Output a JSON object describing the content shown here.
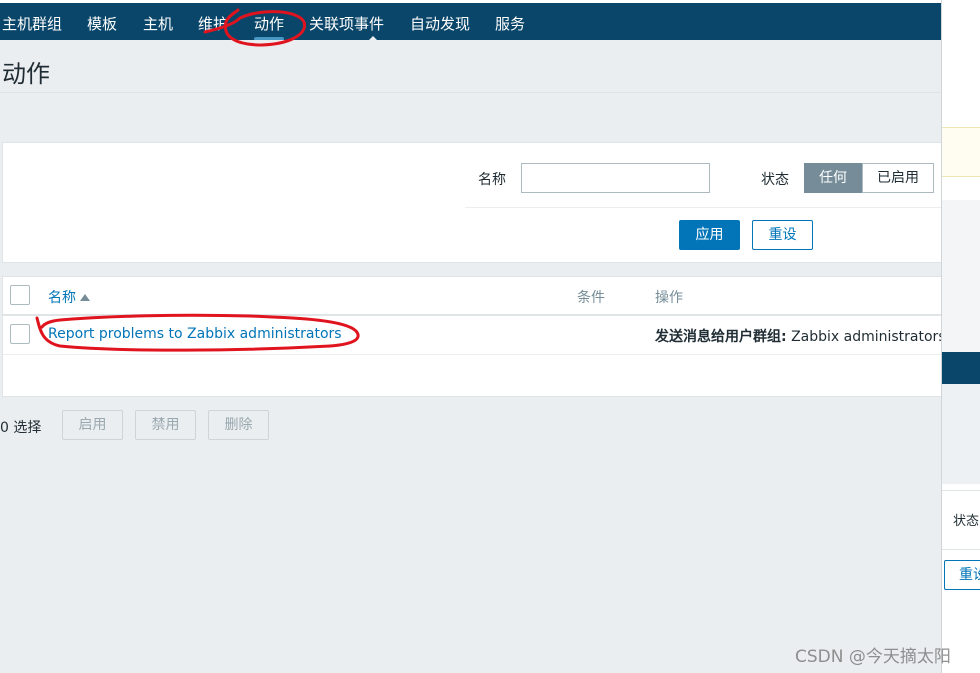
{
  "nav": {
    "items": [
      {
        "label": "主机群组"
      },
      {
        "label": "模板"
      },
      {
        "label": "主机"
      },
      {
        "label": "维护"
      },
      {
        "label": "动作"
      },
      {
        "label": "关联项事件"
      },
      {
        "label": "自动发现"
      },
      {
        "label": "服务"
      }
    ],
    "active_index": 4
  },
  "page": {
    "title": "动作"
  },
  "filter": {
    "name_label": "名称",
    "name_value": "",
    "status_label": "状态",
    "status_options": [
      "任何",
      "已启用"
    ],
    "status_selected": "任何",
    "apply_label": "应用",
    "reset_label": "重设"
  },
  "table": {
    "columns": {
      "name": "名称",
      "conditions": "条件",
      "operations": "操作"
    },
    "sort_column": "名称",
    "rows": [
      {
        "name": "Report problems to Zabbix administrators",
        "conditions": "",
        "operation_prefix": "发送消息给用户群组:",
        "operation_value": "Zabbix administrators"
      }
    ]
  },
  "footer": {
    "selected_count": "0 选择",
    "enable_label": "启用",
    "disable_label": "禁用",
    "delete_label": "删除"
  },
  "overlay": {
    "status_label": "状态",
    "button_label": "重设"
  },
  "watermark": "CSDN @今天摘太阳",
  "colors": {
    "nav_bg": "#0a466a",
    "accent": "#0275b8",
    "page_bg": "#ebeef0",
    "annotation": "#e0141e"
  }
}
